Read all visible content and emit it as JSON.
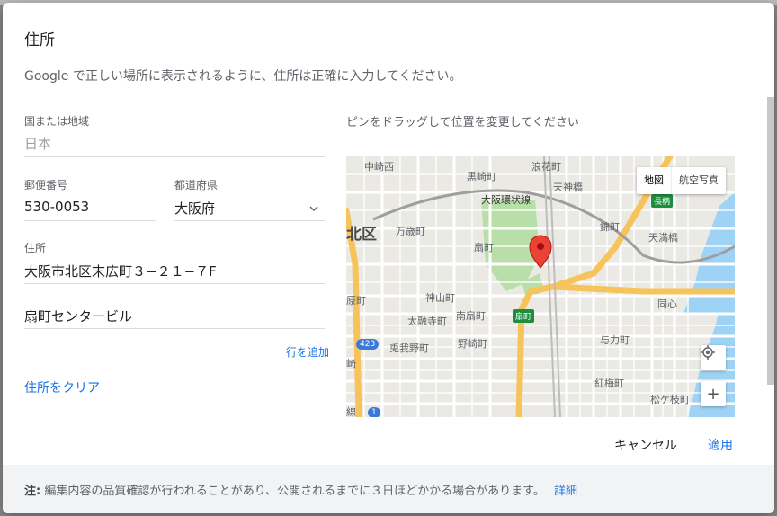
{
  "dialog": {
    "title": "住所",
    "subtitle": "Google で正しい場所に表示されるように、住所は正確に入力してください。"
  },
  "form": {
    "country": {
      "label": "国または地域",
      "value": "日本"
    },
    "postal": {
      "label": "郵便番号",
      "value": "530-0053"
    },
    "prefecture": {
      "label": "都道府県",
      "value": "大阪府"
    },
    "address": {
      "label": "住所",
      "line1": "大阪市北区末広町３−２１−７F",
      "line2": "扇町センタービル"
    },
    "add_line": "行を追加",
    "clear": "住所をクリア"
  },
  "map": {
    "hint": "ピンをドラッグして位置を変更してください",
    "type_map": "地図",
    "type_satellite": "航空写真",
    "locate_icon": "my-location-icon",
    "zoom_in": "+",
    "labels": {
      "nakazakinishi": "中崎西",
      "kurosakicho": "黒崎町",
      "namikicho": "浪花町",
      "tenjinbashi": "天神橋",
      "osaka_loop": "大阪環状線",
      "nagara": "長柄",
      "kitaku": "北区",
      "mansaicho": "万歳町",
      "ougicho": "扇町",
      "nishikicho": "錦町",
      "tenmabashi": "天満橋",
      "haramachi": "原町",
      "kamiyamacho": "神山町",
      "doshin": "同心",
      "taiyujicho": "太融寺町",
      "minamiougicho": "南扇町",
      "ougi_station": "扇町",
      "yoriki": "与力町",
      "kenganajicho": "兎我野町",
      "nozakicho": "野崎町",
      "route": "423",
      "saki": "崎",
      "koubaicho": "紅梅町",
      "matsugaedacho": "松ケ枝町",
      "route2": "1",
      "sen": "線"
    }
  },
  "actions": {
    "cancel": "キャンセル",
    "apply": "適用"
  },
  "footer": {
    "note_label": "注:",
    "note": "編集内容の品質確認が行われることがあり、公開されるまでに３日ほどかかる場合があります。",
    "link": "詳細"
  }
}
